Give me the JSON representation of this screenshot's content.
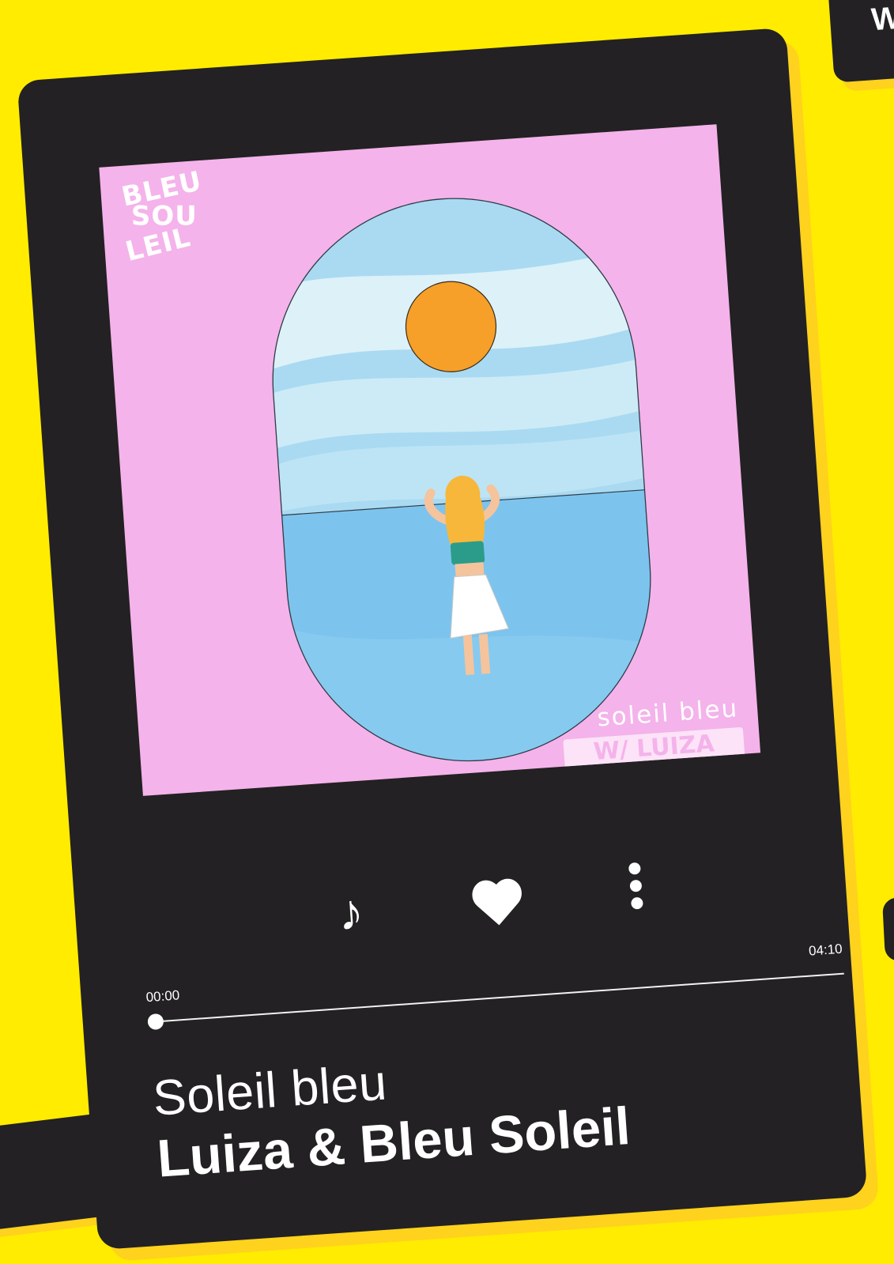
{
  "background": {
    "color": "#FFEC00",
    "shadow_color": "#FFD21E"
  },
  "corner_card": {
    "letter": "W"
  },
  "player": {
    "card_color": "#232123",
    "cover": {
      "logo_lines": [
        "BLEU",
        "SOU",
        "LEIL"
      ],
      "title": "soleil bleu",
      "tag": "W/ LUIZA",
      "colors": {
        "background": "#F4B3EA",
        "sky_light": "#DDF1F8",
        "sky_blue": "#A9DAF2",
        "sea": "#7CC4EE",
        "sun": "#F6A02A"
      }
    },
    "controls": {
      "music_icon": "music-note-icon",
      "like_icon": "heart-icon",
      "more_icon": "more-vertical-icon"
    },
    "progress": {
      "current_time": "00:00",
      "total_time": "04:10",
      "position": 0
    },
    "song": {
      "title": "Soleil bleu",
      "artist": "Luiza & Bleu Soleil"
    }
  }
}
